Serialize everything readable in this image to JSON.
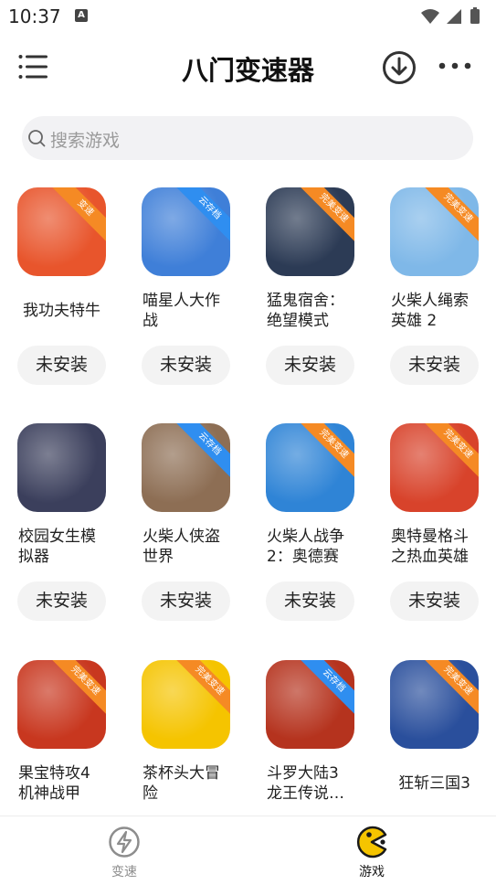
{
  "status_bar": {
    "time": "10:37",
    "indicator": "A"
  },
  "header": {
    "title": "八门变速器"
  },
  "search": {
    "placeholder": "搜索游戏"
  },
  "colors": {
    "ribbon_orange": "#f58a24",
    "ribbon_blue": "#2f8ef0",
    "active_tab": "#1a1a1a",
    "inactive_tab": "#8d8d8d",
    "pacman_yellow": "#f5c400"
  },
  "games": [
    {
      "name": "我功夫特牛",
      "ribbon": "变速",
      "ribbon_color": "orange",
      "button": "未安装",
      "icon": "kungfu-icon",
      "bg": "#e8552c"
    },
    {
      "name": "喵星人大作\n战",
      "ribbon": "云存档",
      "ribbon_color": "blue",
      "button": "未安装",
      "icon": "battle-cats-icon",
      "bg": "#3f7fd8"
    },
    {
      "name": "猛鬼宿舍：\n绝望模式",
      "ribbon": "完美变速",
      "ribbon_color": "orange",
      "button": "未安装",
      "icon": "ghost-dorm-icon",
      "bg": "#2c3b55"
    },
    {
      "name": "火柴人绳索\n英雄 2",
      "ribbon": "完美变速",
      "ribbon_color": "orange",
      "button": "未安装",
      "icon": "rope-hero-icon",
      "bg": "#7fb8e8"
    },
    {
      "name": "校园女生模\n拟器",
      "ribbon": "",
      "ribbon_color": "",
      "button": "未安装",
      "icon": "school-girl-icon",
      "bg": "#3b3f5c"
    },
    {
      "name": "火柴人侠盗\n世界",
      "ribbon": "云存档",
      "ribbon_color": "blue",
      "button": "未安装",
      "icon": "stickman-crime-icon",
      "bg": "#8d6e54"
    },
    {
      "name": "火柴人战争\n2：奥德赛",
      "ribbon": "完美变速",
      "ribbon_color": "orange",
      "button": "未安装",
      "icon": "stick-war-icon",
      "bg": "#2f84d6"
    },
    {
      "name": "奥特曼格斗\n之热血英雄",
      "ribbon": "完美变速",
      "ribbon_color": "orange",
      "button": "未安装",
      "icon": "ultraman-icon",
      "bg": "#d8432b"
    },
    {
      "name": "果宝特攻4\n机神战甲",
      "ribbon": "完美变速",
      "ribbon_color": "orange",
      "button": "",
      "icon": "fruit-robot-icon",
      "bg": "#c8371f"
    },
    {
      "name": "茶杯头大冒\n险",
      "ribbon": "完美变速",
      "ribbon_color": "orange",
      "button": "",
      "icon": "cuphead-icon",
      "bg": "#f5c400"
    },
    {
      "name": "斗罗大陆3\n龙王传说…",
      "ribbon": "云存档",
      "ribbon_color": "blue",
      "button": "",
      "icon": "douluo-icon",
      "bg": "#b5331e"
    },
    {
      "name": "狂斩三国3",
      "ribbon": "完美变速",
      "ribbon_color": "orange",
      "button": "",
      "icon": "three-kingdoms-icon",
      "bg": "#2a4f9c"
    }
  ],
  "tabs": [
    {
      "label": "变速",
      "icon": "speed-icon",
      "active": false
    },
    {
      "label": "游戏",
      "icon": "pacman-icon",
      "active": true
    }
  ]
}
